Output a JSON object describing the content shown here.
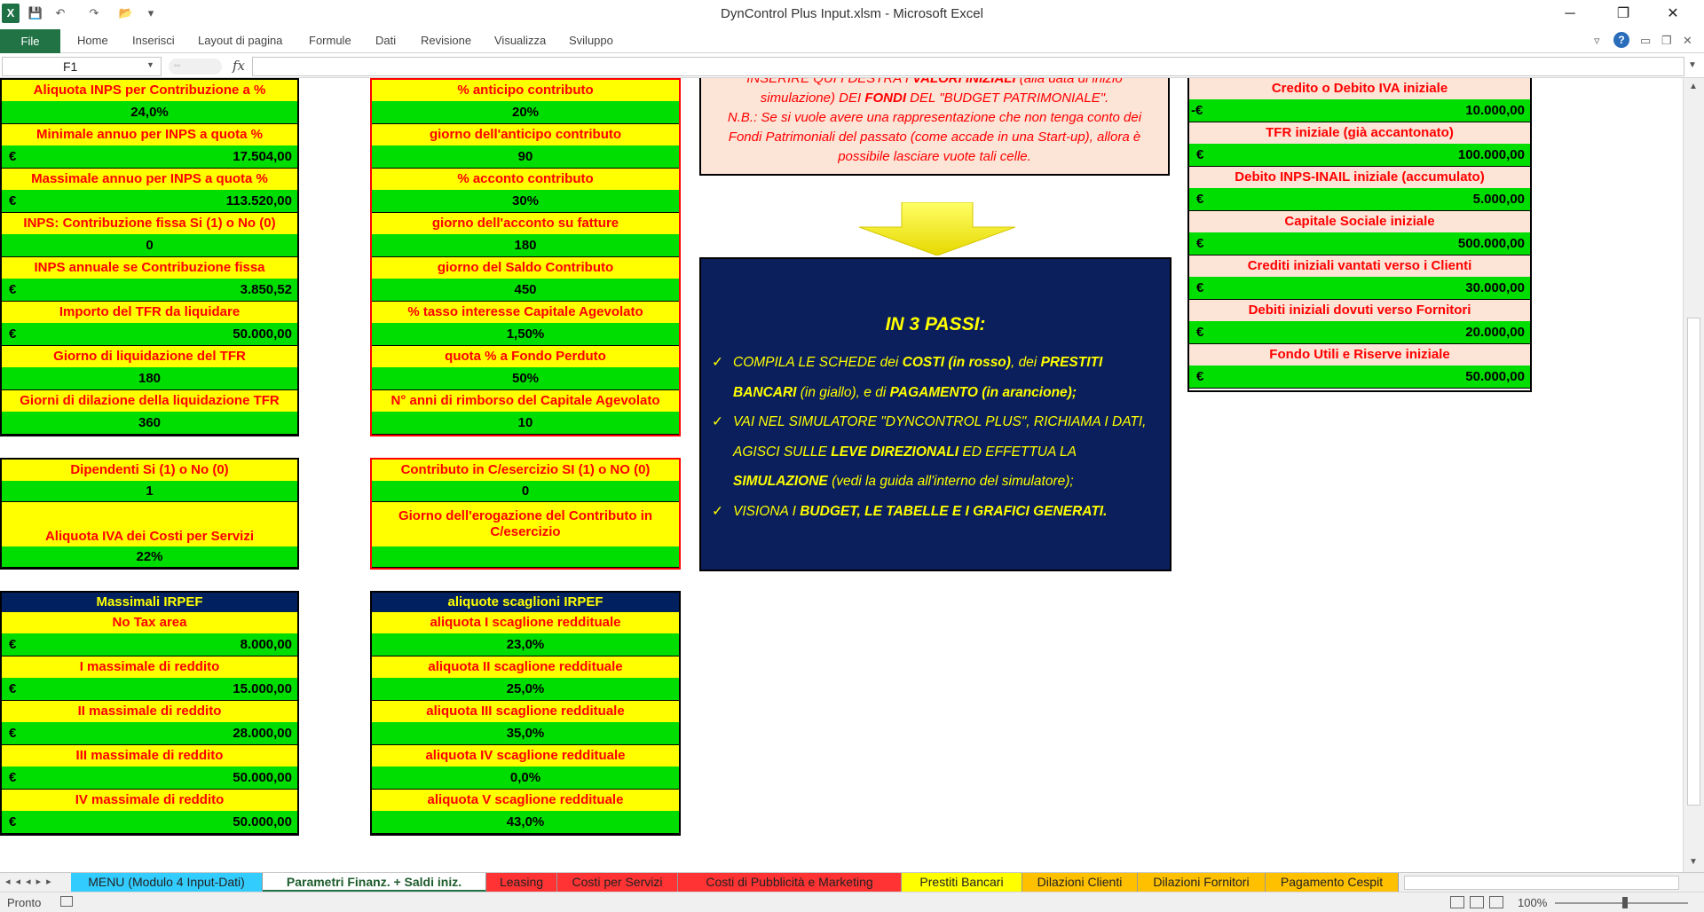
{
  "window": {
    "title": "DynControl Plus Input.xlsm  -  Microsoft Excel",
    "logo": "X",
    "minimize": "─",
    "restore": "❐",
    "close": "✕"
  },
  "ribbon": {
    "file": "File",
    "tabs": [
      "Home",
      "Inserisci",
      "Layout di pagina",
      "Formule",
      "Dati",
      "Revisione",
      "Visualizza",
      "Sviluppo"
    ],
    "help": "?"
  },
  "formula_bar": {
    "name_box": "F1",
    "fx": "fx",
    "value": ""
  },
  "col_a": [
    {
      "label": "Aliquota INPS per Contribuzione a %",
      "currency": "",
      "value": "24,0%"
    },
    {
      "label": "Minimale annuo per INPS a quota %",
      "currency": "€",
      "value": "17.504,00"
    },
    {
      "label": "Massimale annuo per INPS a quota %",
      "currency": "€",
      "value": "113.520,00"
    },
    {
      "label": "INPS: Contribuzione fissa  Si (1) o No (0)",
      "currency": "",
      "value": "0"
    },
    {
      "label": "INPS annuale se Contribuzione fissa",
      "currency": "€",
      "value": "3.850,52"
    },
    {
      "label": "Importo del TFR da liquidare",
      "currency": "€",
      "value": "50.000,00"
    },
    {
      "label": "Giorno di liquidazione del TFR",
      "currency": "",
      "value": "180"
    },
    {
      "label": "Giorni di dilazione della liquidazione TFR",
      "currency": "",
      "value": "360"
    }
  ],
  "col_a2": {
    "dip_label": "Dipendenti Si (1) o No (0)",
    "dip_value": "1",
    "iva_label": "Aliquota IVA dei Costi per Servizi",
    "iva_value": "22%"
  },
  "col_b": [
    {
      "label": "% anticipo contributo",
      "value": "20%"
    },
    {
      "label": "giorno dell'anticipo contributo",
      "value": "90"
    },
    {
      "label": "% acconto contributo",
      "value": "30%"
    },
    {
      "label": "giorno dell'acconto su fatture",
      "value": "180"
    },
    {
      "label": "giorno del Saldo Contributo",
      "value": "450"
    },
    {
      "label": "% tasso interesse Capitale Agevolato",
      "value": "1,50%"
    },
    {
      "label": "quota % a Fondo Perduto",
      "value": "50%"
    },
    {
      "label": "N° anni di rimborso del Capitale Agevolato",
      "value": "10"
    }
  ],
  "col_b2": {
    "c_label": "Contributo in C/esercizio SI (1) o NO (0)",
    "c_value": "0",
    "g_label": "Giorno dell'erogazione del Contributo in C/esercizio",
    "g_value": ""
  },
  "irpef_massimali": {
    "header": "Massimali IRPEF",
    "rows": [
      {
        "label": "No Tax area",
        "value": "8.000,00"
      },
      {
        "label": "I massimale di reddito",
        "value": "15.000,00"
      },
      {
        "label": "II massimale di reddito",
        "value": "28.000,00"
      },
      {
        "label": "III massimale di reddito",
        "value": "50.000,00"
      },
      {
        "label": "IV massimale di reddito",
        "value": "50.000,00"
      }
    ]
  },
  "irpef_aliquote": {
    "header": "aliquote scaglioni IRPEF",
    "rows": [
      {
        "label": "aliquota I scaglione reddituale",
        "value": "23,0%"
      },
      {
        "label": "aliquota II scaglione reddituale",
        "value": "25,0%"
      },
      {
        "label": "aliquota III scaglione reddituale",
        "value": "35,0%"
      },
      {
        "label": "aliquota IV scaglione reddituale",
        "value": "0,0%"
      },
      {
        "label": "aliquota V scaglione reddituale",
        "value": "43,0%"
      }
    ]
  },
  "note": {
    "line1_a": "INSERIRE QUI I DESTRA I ",
    "line1_b": "VALORI INIZIALI",
    "line1_c": " (alla data di inizio",
    "line2_a": "simulazione)   DEI ",
    "line2_b": "FONDI",
    "line2_c": " DEL \"BUDGET PATRIMONIALE\".",
    "line3": "N.B.: Se si vuole avere una rappresentazione che non tenga conto dei Fondi Patrimoniali del passato (come accade in una Start-up), allora è possibile lasciare vuote tali celle."
  },
  "steps": {
    "title": "IN 3 PASSI:",
    "s1_a": "COMPILA  LE SCHEDE dei ",
    "s1_b": "COSTI (in rosso)",
    "s1_c": ",  dei ",
    "s1_d": "PRESTITI BANCARI",
    "s1_e": " (in giallo),  e di ",
    "s1_f": "PAGAMENTO (in arancione);",
    "s2_a": "VAI NEL SIMULATORE \"DYNCONTROL PLUS\", RICHIAMA I DATI, AGISCI SULLE ",
    "s2_b": "LEVE DIREZIONALI",
    "s2_c": " ED EFFETTUA LA ",
    "s2_d": "SIMULAZIONE",
    "s2_e": " (vedi la guida  all'interno  del simulatore);",
    "s3_a": "VISIONA I ",
    "s3_b": "BUDGET,  LE TABELLE E I GRAFICI GENERATI."
  },
  "fondi": [
    {
      "label": "Credito o Debito IVA iniziale",
      "currency": "-€",
      "value": "10.000,00"
    },
    {
      "label": "TFR iniziale (già accantonato)",
      "currency": "€",
      "value": "100.000,00"
    },
    {
      "label": "Debito INPS-INAIL iniziale (accumulato)",
      "currency": "€",
      "value": "5.000,00"
    },
    {
      "label": "Capitale Sociale iniziale",
      "currency": "€",
      "value": "500.000,00"
    },
    {
      "label": "Crediti iniziali vantati verso i Clienti",
      "currency": "€",
      "value": "30.000,00"
    },
    {
      "label": "Debiti iniziali dovuti verso Fornitori",
      "currency": "€",
      "value": "20.000,00"
    },
    {
      "label": "Fondo Utili e Riserve iniziale",
      "currency": "€",
      "value": "50.000,00"
    }
  ],
  "sheet_tabs": [
    {
      "label": "MENU (Modulo 4 Input-Dati)",
      "color": "#33ccff"
    },
    {
      "label": "Parametri Finanz. + Saldi iniz.",
      "color": "#ffffff"
    },
    {
      "label": "Leasing",
      "color": "#ff3333"
    },
    {
      "label": "Costi per Servizi",
      "color": "#ff3333"
    },
    {
      "label": "Costi di Pubblicità e Marketing",
      "color": "#ff3333"
    },
    {
      "label": "Prestiti Bancari",
      "color": "#ffff00"
    },
    {
      "label": "Dilazioni Clienti",
      "color": "#ffc000"
    },
    {
      "label": "Dilazioni Fornitori",
      "color": "#ffc000"
    },
    {
      "label": "Pagamento Cespit",
      "color": "#ffc000"
    }
  ],
  "status": {
    "ready": "Pronto",
    "zoom": "100%"
  }
}
